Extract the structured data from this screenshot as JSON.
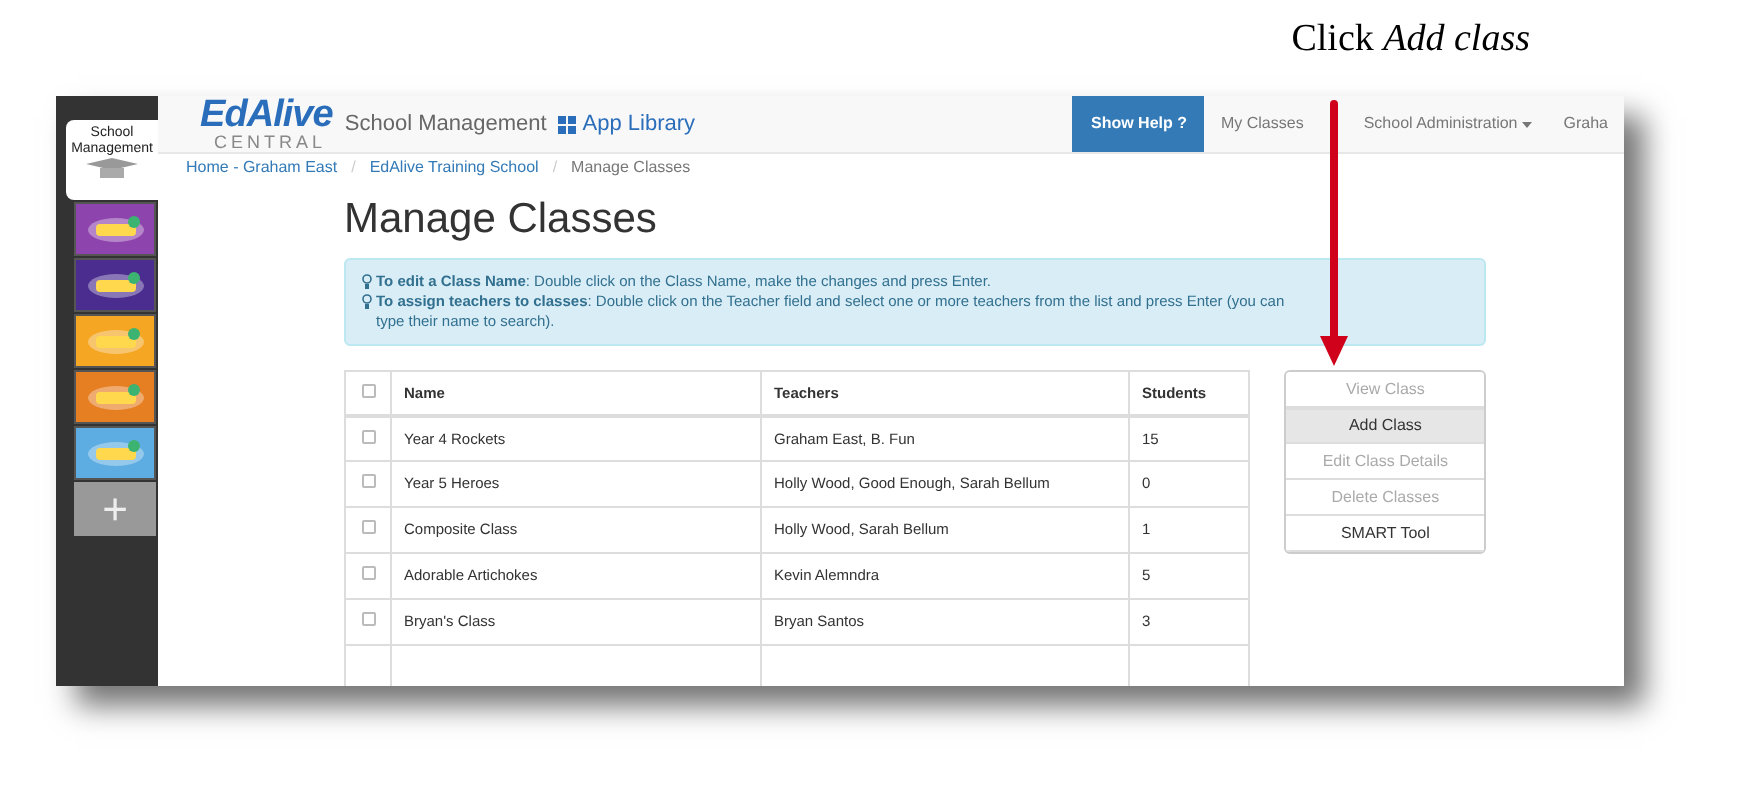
{
  "caption": "Click *Add class*",
  "sidebar": {
    "items": [
      {
        "kind": "home",
        "label": "School Management",
        "selected": true
      },
      {
        "kind": "app",
        "color": "#8e44ad"
      },
      {
        "kind": "app",
        "color": "#4b2d8f"
      },
      {
        "kind": "app",
        "color": "#f5a623"
      },
      {
        "kind": "app",
        "color": "#e67e22"
      },
      {
        "kind": "app",
        "color": "#5dade2"
      },
      {
        "kind": "add",
        "label": "+"
      }
    ]
  },
  "navbar": {
    "logo_main": "EdAlive",
    "logo_sub": "CENTRAL",
    "title": "School Management",
    "app_library": "App Library",
    "items": [
      {
        "label": "Show Help ?",
        "kind": "primary"
      },
      {
        "label": "My Classes",
        "kind": "link"
      },
      {
        "label": "School Administration",
        "kind": "dropdown"
      },
      {
        "label": "Graha",
        "kind": "link"
      }
    ]
  },
  "breadcrumb": [
    {
      "label": "Home - Graham East",
      "link": true
    },
    {
      "separator": "/",
      "label": "EdAlive Training School",
      "link": true
    },
    {
      "separator": "/",
      "label": "Manage Classes",
      "link": false
    }
  ],
  "title": "Manage Classes",
  "help": [
    "**To edit a Class Name**: Double click on the Class Name, make the changes and press Enter.",
    "**To assign teachers to classes**: Double click on the Teacher field and select one or more teachers from the list and press Enter (you can type their name to search)."
  ],
  "table": {
    "header_checked": false,
    "columns": [
      "Name",
      "Teachers",
      "Students"
    ],
    "rows": [
      {
        "checked": false,
        "cells": [
          "Year 4 Rockets",
          "Graham East, B. Fun",
          "15"
        ]
      },
      {
        "checked": false,
        "cells": [
          "Year 5 Heroes",
          "Holly Wood, Good Enough, Sarah Bellum",
          "0"
        ]
      },
      {
        "checked": false,
        "cells": [
          "Composite Class",
          "Holly Wood, Sarah Bellum",
          "1"
        ]
      },
      {
        "checked": false,
        "cells": [
          "Adorable Artichokes",
          "Kevin Alemndra",
          "5"
        ]
      },
      {
        "checked": false,
        "cells": [
          "Bryan's Class",
          "Bryan Santos",
          "3"
        ]
      }
    ]
  },
  "actions": [
    {
      "label": "View Class",
      "disabled": true,
      "selected": false
    },
    {
      "label": "Add Class",
      "disabled": false,
      "selected": true
    },
    {
      "label": "Edit Class Details",
      "disabled": true,
      "selected": false
    },
    {
      "label": "Delete Classes",
      "disabled": true,
      "selected": false
    },
    {
      "label": "SMART Tool",
      "disabled": false,
      "selected": false
    }
  ]
}
